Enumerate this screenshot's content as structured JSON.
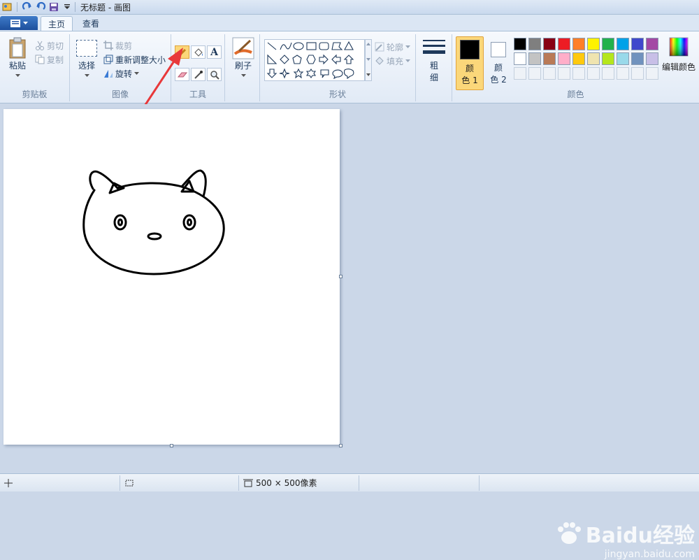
{
  "window": {
    "title": "无标题 - 画图"
  },
  "tabs": {
    "home": "主页",
    "view": "查看"
  },
  "clipboard": {
    "paste": "粘贴",
    "cut": "剪切",
    "copy": "复制",
    "group": "剪贴板"
  },
  "image": {
    "select": "选择",
    "crop": "裁剪",
    "resize": "重新调整大小",
    "rotate": "旋转",
    "group": "图像"
  },
  "tools": {
    "group": "工具",
    "selected": "pencil-icon"
  },
  "brushes": {
    "label": "刷子"
  },
  "shapes": {
    "outline": "轮廓",
    "fill": "填充",
    "group": "形状"
  },
  "size": {
    "label_top": "粗",
    "label_bottom": "细"
  },
  "colors": {
    "color1_top": "颜",
    "color1_bottom": "色 1",
    "color2_top": "颜",
    "color2_bottom": "色 2",
    "edit": "编辑颜色",
    "group": "颜色",
    "palette_row1": [
      "#000000",
      "#7f7f7f",
      "#880015",
      "#ed1c24",
      "#ff7f27",
      "#fff200",
      "#22b14c",
      "#00a2e8",
      "#3f48cc",
      "#a349a4"
    ],
    "palette_row2": [
      "#ffffff",
      "#c3c3c3",
      "#b97a57",
      "#ffaec9",
      "#ffc90e",
      "#efe4b0",
      "#b5e61d",
      "#99d9ea",
      "#7092be",
      "#c8bfe7"
    ],
    "color1": "#000000",
    "color2": "#ffffff"
  },
  "status": {
    "dimensions": "500 × 500像素"
  },
  "watermark": {
    "brand": "Baidu经验",
    "url": "jingyan.baidu.com"
  }
}
